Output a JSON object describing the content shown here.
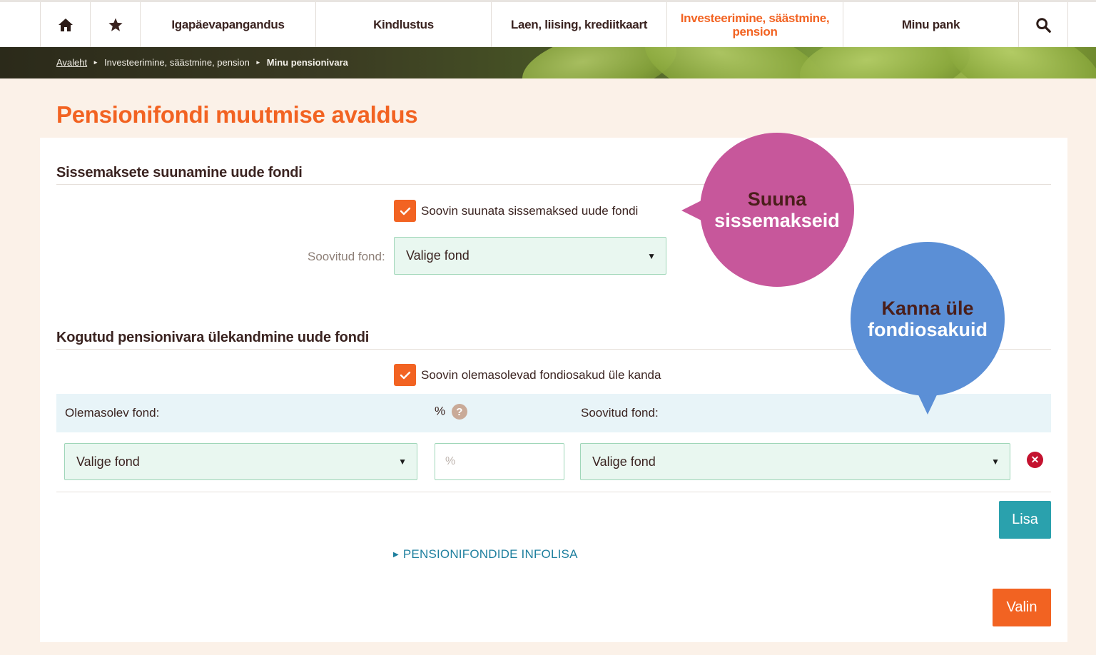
{
  "nav": {
    "items": [
      {
        "label": "Igapäevapangandus"
      },
      {
        "label": "Kindlustus"
      },
      {
        "label": "Laen, liising, krediitkaart"
      },
      {
        "label": "Investeerimine, säästmine, pension"
      },
      {
        "label": "Minu pank"
      }
    ],
    "icons": [
      "home-icon",
      "star-icon",
      "search-icon"
    ],
    "accent": "#f26322"
  },
  "breadcrumb": {
    "home": "Avaleht",
    "section": "Investeerimine, säästmine, pension",
    "current": "Minu pensionivara"
  },
  "page": {
    "title": "Pensionifondi muutmise avaldus"
  },
  "section1": {
    "heading": "Sissemaksete suunamine uude fondi",
    "checkbox_label": "Soovin suunata sissemaksed uude fondi",
    "checkbox_checked": true,
    "fund_label": "Soovitud fond:",
    "fund_value": "Valige fond"
  },
  "section2": {
    "heading": "Kogutud pensionivara ülekandmine uude fondi",
    "checkbox_label": "Soovin olemasolevad fondiosakud üle kanda",
    "checkbox_checked": true,
    "col_existing": "Olemasolev fond:",
    "col_percent": "%",
    "col_target": "Soovitud fond:",
    "row": {
      "existing_value": "Valige fond",
      "percent_placeholder": "%",
      "target_value": "Valige fond"
    },
    "add_button": "Lisa"
  },
  "info_link": "PENSIONIFONDIDE INFOLISA",
  "submit_button": "Valin",
  "callouts": {
    "pink": {
      "line1": "Suuna",
      "line2": "sissemakseid"
    },
    "blue": {
      "line1": "Kanna üle",
      "line2": "fondiosakuid"
    }
  }
}
